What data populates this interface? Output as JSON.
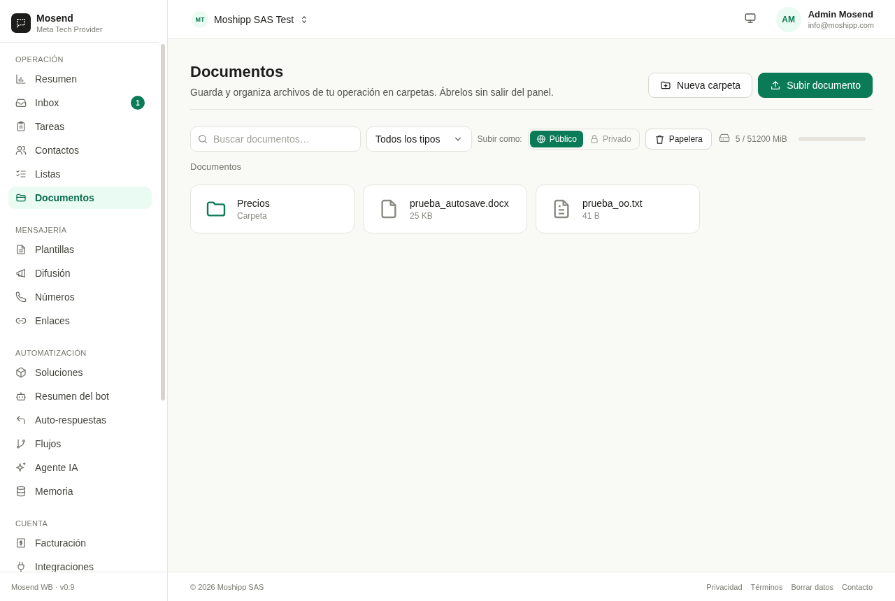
{
  "brand": {
    "name": "Mosend",
    "subtitle": "Meta Tech Provider"
  },
  "sidebar": {
    "sections": [
      {
        "title": "OPERACIÓN",
        "items": [
          {
            "label": "Resumen",
            "selected": false
          },
          {
            "label": "Inbox",
            "selected": false,
            "badge": "1"
          },
          {
            "label": "Tareas",
            "selected": false
          },
          {
            "label": "Contactos",
            "selected": false
          },
          {
            "label": "Listas",
            "selected": false
          },
          {
            "label": "Documentos",
            "selected": true
          }
        ]
      },
      {
        "title": "MENSAJERÍA",
        "items": [
          {
            "label": "Plantillas",
            "selected": false
          },
          {
            "label": "Difusión",
            "selected": false
          },
          {
            "label": "Números",
            "selected": false
          },
          {
            "label": "Enlaces",
            "selected": false
          }
        ]
      },
      {
        "title": "AUTOMATIZACIÓN",
        "items": [
          {
            "label": "Soluciones",
            "selected": false
          },
          {
            "label": "Resumen del bot",
            "selected": false
          },
          {
            "label": "Auto-respuestas",
            "selected": false
          },
          {
            "label": "Flujos",
            "selected": false
          },
          {
            "label": "Agente IA",
            "selected": false
          },
          {
            "label": "Memoria",
            "selected": false
          }
        ]
      },
      {
        "title": "CUENTA",
        "items": [
          {
            "label": "Facturación",
            "selected": false
          },
          {
            "label": "Integraciones",
            "selected": false
          }
        ]
      }
    ],
    "version": "Mosend WB · v0.9"
  },
  "topbar": {
    "workspace_initials": "MT",
    "workspace": "Moshipp SAS Test",
    "user_initials": "AM",
    "user_name": "Admin Mosend",
    "user_email": "info@moshipp.com"
  },
  "page": {
    "title": "Documentos",
    "subtitle": "Guarda y organiza archivos de tu operación en carpetas. Ábrelos sin salir del panel.",
    "buttons": [
      {
        "label": "Nueva carpeta",
        "kind": "secondary"
      },
      {
        "label": "Subir documento",
        "kind": "primary"
      }
    ]
  },
  "toolbar": {
    "search": {
      "placeholder": "Buscar documentos…"
    },
    "type_filter": "Todos los tipos",
    "upload_as_label": "Subir como:",
    "visibility": [
      {
        "label": "Público",
        "selected": true
      },
      {
        "label": "Privado",
        "selected": false
      }
    ],
    "trash": "Papelera",
    "storage": {
      "reading": "5 / 51200 MiB",
      "level": 0.0001
    }
  },
  "breadcrumb": "Documentos",
  "items": [
    {
      "kind": "folder",
      "name": "Precios",
      "meta": "Carpeta"
    },
    {
      "kind": "file",
      "name": "prueba_autosave.docx",
      "meta": "25 KB"
    },
    {
      "kind": "text",
      "name": "prueba_oo.txt",
      "meta": "41 B"
    }
  ],
  "footer": {
    "copyright": "© 2026 Moshipp SAS",
    "links": [
      "Privacidad",
      "Términos",
      "Borrar datos",
      "Contacto"
    ]
  }
}
